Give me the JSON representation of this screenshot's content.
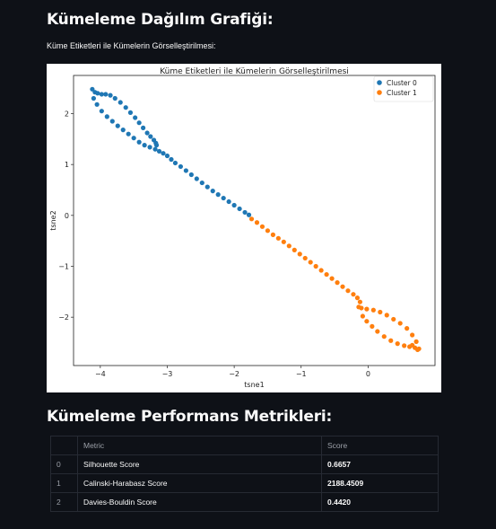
{
  "page": {
    "title": "Kümeleme Dağılım Grafiği:",
    "subtitle": "Küme Etiketleri ile Kümelerin Görselleştirilmesi:",
    "metrics_title": "Kümeleme Performans Metrikleri:"
  },
  "chart_data": {
    "type": "scatter",
    "title": "Küme Etiketleri ile Kümelerin Görselleştirilmesi",
    "xlabel": "tsne1",
    "ylabel": "tsne2",
    "xlim": [
      -4.4,
      1.0
    ],
    "ylim": [
      -2.95,
      2.75
    ],
    "xticks": [
      "−4",
      "−3",
      "−2",
      "−1",
      "0"
    ],
    "yticks": [
      "2",
      "1",
      "0",
      "−1",
      "−2"
    ],
    "legend_position": "top-right",
    "series": [
      {
        "name": "Cluster 0",
        "color": "#1f77b4",
        "x": [
          -4.12,
          -4.08,
          -4.04,
          -3.98,
          -3.92,
          -3.85,
          -3.78,
          -3.7,
          -3.62,
          -3.55,
          -3.48,
          -3.42,
          -3.36,
          -3.3,
          -3.25,
          -3.2,
          -3.17,
          -3.16,
          -4.1,
          -4.05,
          -3.98,
          -3.9,
          -3.82,
          -3.74,
          -3.66,
          -3.58,
          -3.5,
          -3.42,
          -3.34,
          -3.26,
          -3.18,
          -3.12,
          -3.06,
          -3.0,
          -2.94,
          -2.88,
          -2.8,
          -2.72,
          -2.64,
          -2.56,
          -2.48,
          -2.4,
          -2.32,
          -2.24,
          -2.16,
          -2.08,
          -2.0,
          -1.92,
          -1.84,
          -1.78
        ],
        "y": [
          2.48,
          2.42,
          2.4,
          2.38,
          2.38,
          2.36,
          2.3,
          2.22,
          2.12,
          2.02,
          1.92,
          1.82,
          1.72,
          1.62,
          1.55,
          1.48,
          1.42,
          1.38,
          2.3,
          2.18,
          2.05,
          1.94,
          1.85,
          1.76,
          1.68,
          1.6,
          1.52,
          1.44,
          1.38,
          1.34,
          1.3,
          1.26,
          1.22,
          1.17,
          1.1,
          1.03,
          0.96,
          0.88,
          0.8,
          0.72,
          0.64,
          0.56,
          0.48,
          0.41,
          0.34,
          0.27,
          0.2,
          0.13,
          0.06,
          0.01
        ]
      },
      {
        "name": "Cluster 1",
        "color": "#ff7f0e",
        "x": [
          -1.74,
          -1.66,
          -1.58,
          -1.5,
          -1.42,
          -1.34,
          -1.26,
          -1.18,
          -1.1,
          -1.02,
          -0.94,
          -0.86,
          -0.78,
          -0.7,
          -0.62,
          -0.54,
          -0.46,
          -0.38,
          -0.3,
          -0.22,
          -0.16,
          -0.12,
          -0.14,
          -0.1,
          -0.02,
          0.08,
          0.18,
          0.28,
          0.38,
          0.48,
          0.58,
          0.66,
          0.72,
          0.76,
          0.74,
          0.7,
          0.66,
          0.62,
          0.54,
          0.44,
          0.34,
          0.24,
          0.14,
          0.06,
          -0.02,
          -0.08
        ],
        "y": [
          -0.07,
          -0.14,
          -0.22,
          -0.3,
          -0.38,
          -0.45,
          -0.52,
          -0.6,
          -0.68,
          -0.76,
          -0.84,
          -0.92,
          -1.0,
          -1.08,
          -1.16,
          -1.24,
          -1.32,
          -1.4,
          -1.48,
          -1.55,
          -1.62,
          -1.7,
          -1.8,
          -1.82,
          -1.84,
          -1.86,
          -1.9,
          -1.96,
          -2.04,
          -2.12,
          -2.22,
          -2.35,
          -2.48,
          -2.62,
          -2.64,
          -2.6,
          -2.55,
          -2.58,
          -2.56,
          -2.52,
          -2.46,
          -2.38,
          -2.28,
          -2.18,
          -2.08,
          -1.98
        ]
      }
    ]
  },
  "metrics_table": {
    "headers": [
      "",
      "Metric",
      "Score"
    ],
    "rows": [
      [
        "0",
        "Silhouette Score",
        "0.6657"
      ],
      [
        "1",
        "Calinski-Harabasz Score",
        "2188.4509"
      ],
      [
        "2",
        "Davies-Bouldin Score",
        "0.4420"
      ]
    ]
  }
}
